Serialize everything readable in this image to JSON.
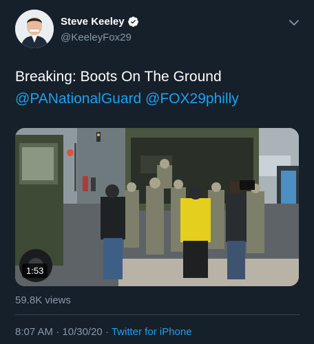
{
  "author": {
    "name": "Steve Keeley",
    "handle": "@KeeleyFox29",
    "verified": true
  },
  "tweet": {
    "text_plain": "Breaking:  Boots On The Ground",
    "mentions": [
      "@PANationalGuard",
      "@FOX29philly"
    ]
  },
  "media": {
    "type": "video",
    "duration": "1:53"
  },
  "stats": {
    "views": "59.8K views"
  },
  "meta": {
    "time": "8:07 AM",
    "separator": " · ",
    "date": "10/30/20",
    "source": "Twitter for iPhone"
  },
  "icons": {
    "verified": "verified-badge-icon",
    "menu": "chevron-down-icon"
  },
  "colors": {
    "background": "#15202b",
    "link": "#1da1f2",
    "secondary_text": "#8899a6",
    "verified_badge": "#ffffff"
  }
}
